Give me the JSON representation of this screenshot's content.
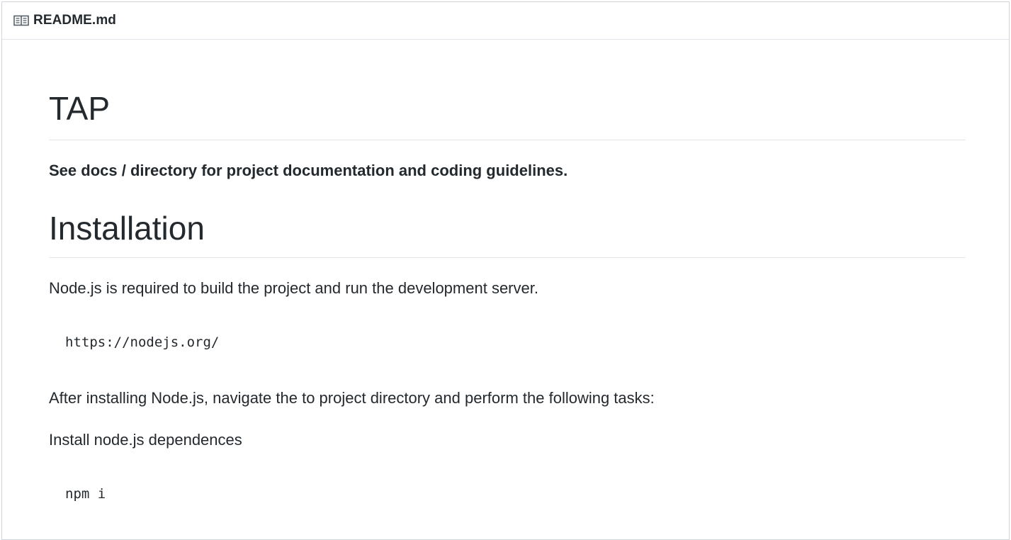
{
  "file": {
    "icon": "book-icon",
    "name": "README.md"
  },
  "readme": {
    "title": "TAP",
    "intro": "See docs / directory for project documentation and coding guidelines.",
    "installation_heading": "Installation",
    "node_required": "Node.js is required to build the project and run the development server.",
    "node_url": "https://nodejs.org/",
    "after_install": "After installing Node.js, navigate the to project directory and perform the following tasks:",
    "install_deps": "Install node.js dependences",
    "npm_command": "npm i"
  }
}
